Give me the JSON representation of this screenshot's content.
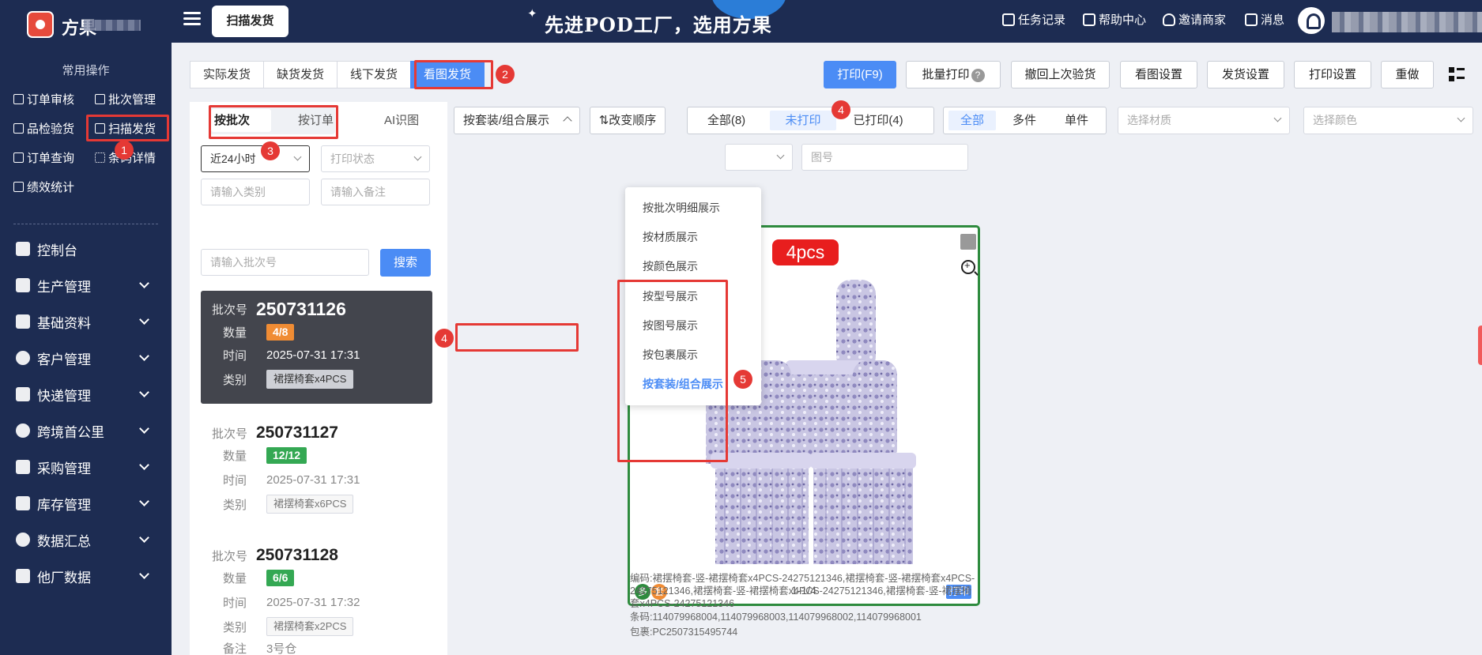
{
  "topbar": {
    "brand": "方果",
    "scan_button": "扫描发货",
    "slogan": "先进POD工厂，选用方果",
    "links": [
      "任务记录",
      "帮助中心",
      "邀请商家",
      "消息"
    ]
  },
  "sidebar": {
    "quick_heading": "常用操作",
    "quick": [
      "订单审核",
      "批次管理",
      "品检验货",
      "扫描发货",
      "订单查询",
      "条码详情",
      "绩效统计"
    ],
    "nav": [
      "控制台",
      "生产管理",
      "基础资料",
      "客户管理",
      "快递管理",
      "跨境首公里",
      "采购管理",
      "库存管理",
      "数据汇总",
      "他厂数据"
    ]
  },
  "tabs": [
    "实际发货",
    "缺货发货",
    "线下发货",
    "看图发货"
  ],
  "toolbar": {
    "print": "打印(F9)",
    "batch_print": "批量打印",
    "undo": "撤回上次验货",
    "view_settings": "看图设置",
    "ship_settings": "发货设置",
    "print_settings": "打印设置",
    "redo": "重做"
  },
  "left": {
    "subtabs": [
      "按批次",
      "按订单",
      "AI识图"
    ],
    "time_range": "近24小时",
    "print_status_placeholder": "打印状态",
    "category_placeholder": "请输入类别",
    "remark_placeholder": "请输入备注",
    "batch_placeholder": "请输入批次号",
    "search": "搜索",
    "labels": {
      "batch": "批次号",
      "qty": "数量",
      "time": "时间",
      "category": "类别",
      "remark": "备注"
    },
    "batches": [
      {
        "no": "250731126",
        "qty": "4/8",
        "time": "2025-07-31 17:31",
        "category": "裙摆椅套x4PCS",
        "remark": ""
      },
      {
        "no": "250731127",
        "qty": "12/12",
        "time": "2025-07-31 17:31",
        "category": "裙摆椅套x6PCS",
        "remark": ""
      },
      {
        "no": "250731128",
        "qty": "6/6",
        "time": "2025-07-31 17:32",
        "category": "裙摆椅套x2PCS",
        "remark": "3号仓"
      }
    ]
  },
  "filters": {
    "display_mode": "按套装/组合展示",
    "order_toggle": "改变顺序",
    "print_states": [
      "全部(8)",
      "未打印",
      "已打印(4)"
    ],
    "piece_types": [
      "全部",
      "多件",
      "单件"
    ],
    "material_placeholder": "选择材质",
    "color_placeholder": "选择颜色",
    "figure_placeholder": "图号"
  },
  "dropdown": [
    "按批次明细展示",
    "按材质展示",
    "按颜色展示",
    "按型号展示",
    "按图号展示",
    "按包裹展示",
    "按套装/组合展示"
  ],
  "card": {
    "badge": "4pcs",
    "pager": "1-1/4",
    "tag_multi": "多",
    "tag_set": "套",
    "print": "打印",
    "code_label": "编码:",
    "code": "裙摆椅套-竖-裙摆椅套x4PCS-24275121346,裙摆椅套-竖-裙摆椅套x4PCS-24275121346,裙摆椅套-竖-裙摆椅套x4PCS-24275121346,裙摆椅套-竖-裙摆椅套x4PCS-24275121346",
    "barcode_label": "条码:",
    "barcode": "114079968004,114079968003,114079968002,114079968001",
    "package_label": "包裹:",
    "package": "PC2507315495744"
  },
  "annotations": [
    "1",
    "2",
    "3",
    "4",
    "4",
    "5"
  ]
}
